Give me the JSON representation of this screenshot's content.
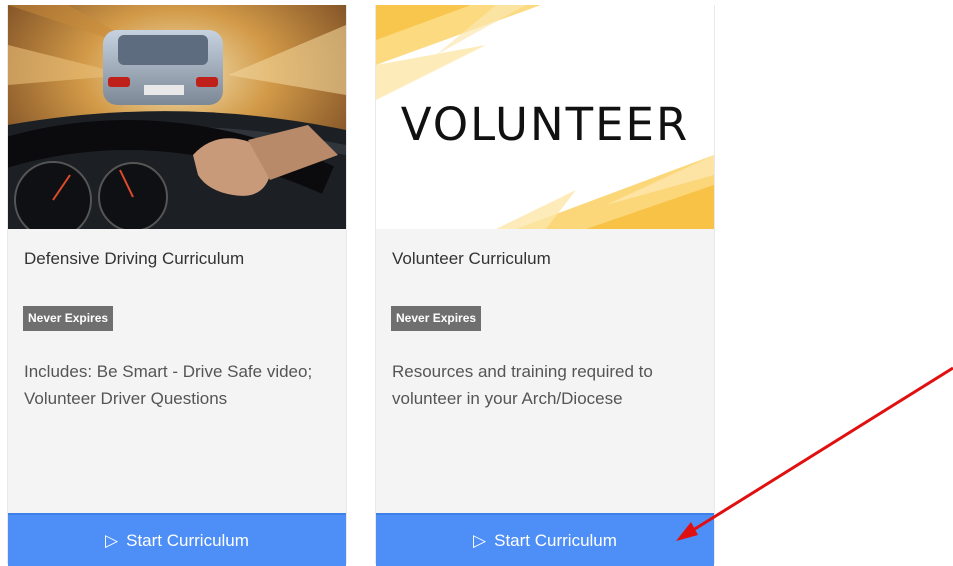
{
  "cards": [
    {
      "image_alt": "car-driving-icon",
      "title": "Defensive Driving Curriculum",
      "badge": "Never Expires",
      "description": "Includes: Be Smart - Drive Safe video; Volunteer Driver Questions",
      "button_label": "Start Curriculum",
      "button_icon": "play-icon"
    },
    {
      "image_alt": "volunteer-banner",
      "image_text": "VOLUNTEER",
      "title": "Volunteer Curriculum",
      "badge": "Never Expires",
      "description": "Resources and training required to volunteer in your Arch/Diocese",
      "button_label": "Start Curriculum",
      "button_icon": "play-icon"
    }
  ],
  "colors": {
    "button_bg": "#4e8ef7",
    "badge_bg": "#6f6f6f",
    "card_bg": "#f4f4f4",
    "annotation_arrow": "#e01010",
    "banner_accent": "#f9c74f"
  }
}
